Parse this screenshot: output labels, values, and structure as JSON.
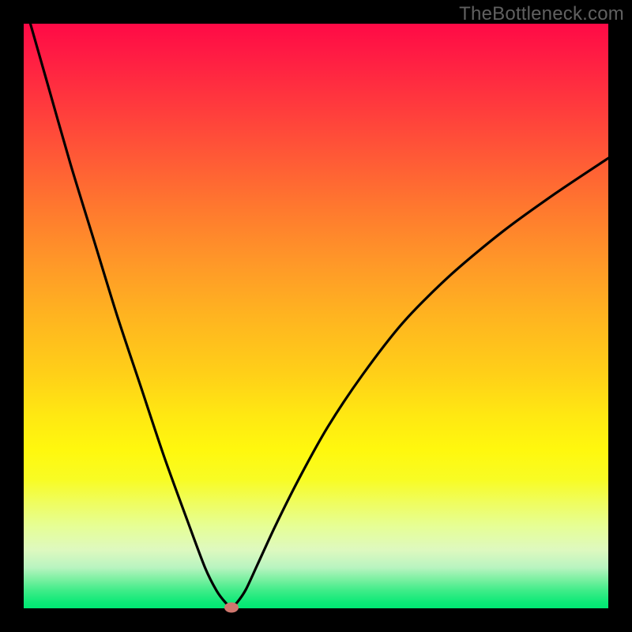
{
  "watermark": "TheBottleneck.com",
  "colors": {
    "background": "#000000",
    "curve": "#000000",
    "marker": "#cf776e",
    "watermark_text": "#606060"
  },
  "chart_data": {
    "type": "line",
    "title": "",
    "xlabel": "",
    "ylabel": "",
    "xlim": [
      0,
      100
    ],
    "ylim": [
      0,
      100
    ],
    "series": [
      {
        "name": "bottleneck-curve",
        "x": [
          0,
          4,
          8,
          12,
          16,
          20,
          24,
          28,
          31,
          33,
          34.5,
          35.5,
          36.5,
          38,
          40,
          43,
          47,
          52,
          58,
          65,
          73,
          82,
          91,
          100
        ],
        "y": [
          104,
          90,
          76,
          63,
          50,
          38,
          26,
          15,
          7,
          3,
          1,
          0.2,
          1,
          3.2,
          7.5,
          14,
          22,
          31,
          40,
          49,
          57,
          64.5,
          71,
          77
        ]
      }
    ],
    "marker": {
      "x": 35.5,
      "y": 0.2
    },
    "gradient_stops": [
      {
        "pct": 0,
        "color": "#ff0a46"
      },
      {
        "pct": 50,
        "color": "#ffb420"
      },
      {
        "pct": 73,
        "color": "#fff80e"
      },
      {
        "pct": 100,
        "color": "#00e873"
      }
    ]
  }
}
